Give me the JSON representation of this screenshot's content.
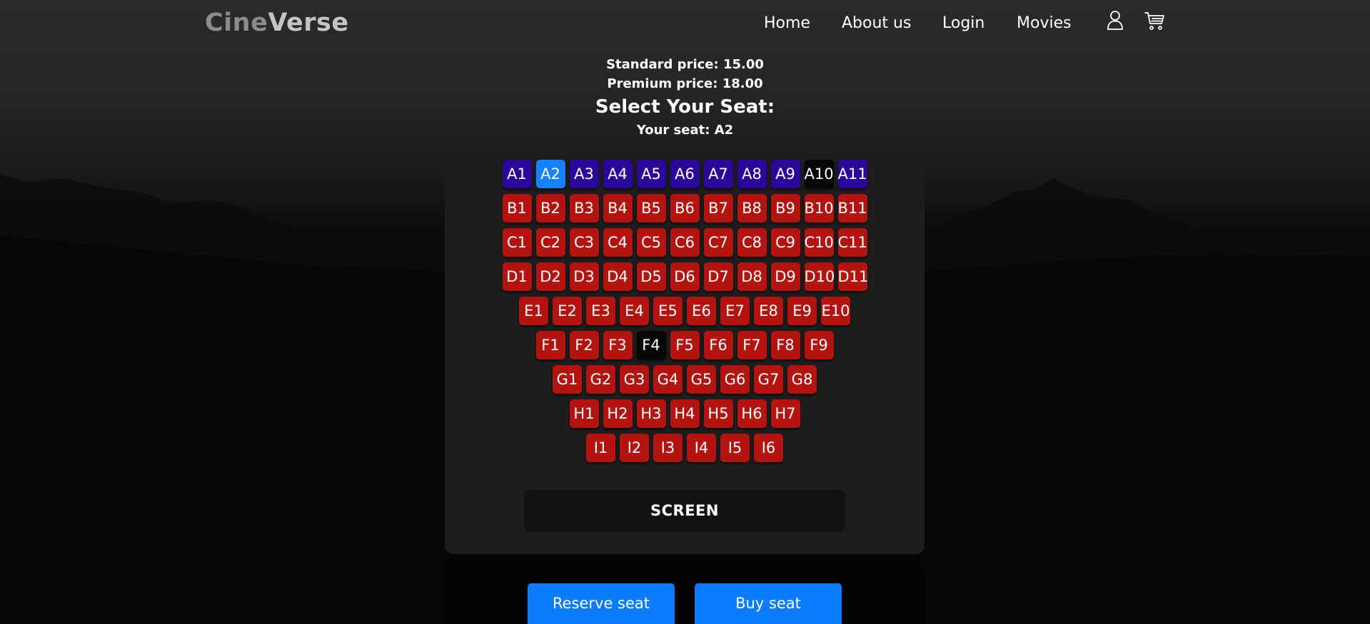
{
  "header": {
    "logo_part1": "Cine",
    "logo_part2": "Verse",
    "nav": [
      "Home",
      "About us",
      "Login",
      "Movies"
    ],
    "icons": [
      "user-icon",
      "cart-icon"
    ]
  },
  "pricing": {
    "standard": "Standard price: 15.00",
    "premium": "Premium price: 18.00"
  },
  "heading": "Select Your Seat:",
  "your_seat": "Your seat: A2",
  "selected_seat": "A2",
  "seat_rows": [
    {
      "row": "A",
      "count": 11,
      "tier": "premium",
      "taken": [
        "A10"
      ]
    },
    {
      "row": "B",
      "count": 11,
      "tier": "standard",
      "taken": []
    },
    {
      "row": "C",
      "count": 11,
      "tier": "standard",
      "taken": []
    },
    {
      "row": "D",
      "count": 11,
      "tier": "standard",
      "taken": []
    },
    {
      "row": "E",
      "count": 10,
      "tier": "standard",
      "taken": []
    },
    {
      "row": "F",
      "count": 9,
      "tier": "standard",
      "taken": [
        "F4"
      ]
    },
    {
      "row": "G",
      "count": 8,
      "tier": "standard",
      "taken": []
    },
    {
      "row": "H",
      "count": 7,
      "tier": "standard",
      "taken": []
    },
    {
      "row": "I",
      "count": 6,
      "tier": "standard",
      "taken": []
    }
  ],
  "screen_label": "SCREEN",
  "buttons": {
    "reserve": "Reserve seat",
    "buy": "Buy seat"
  },
  "colors": {
    "premium_seat": "#28079a",
    "standard_seat": "#b3140f",
    "selected_seat": "#1680ff",
    "taken_seat": "#060606",
    "button": "#0b7cff"
  }
}
